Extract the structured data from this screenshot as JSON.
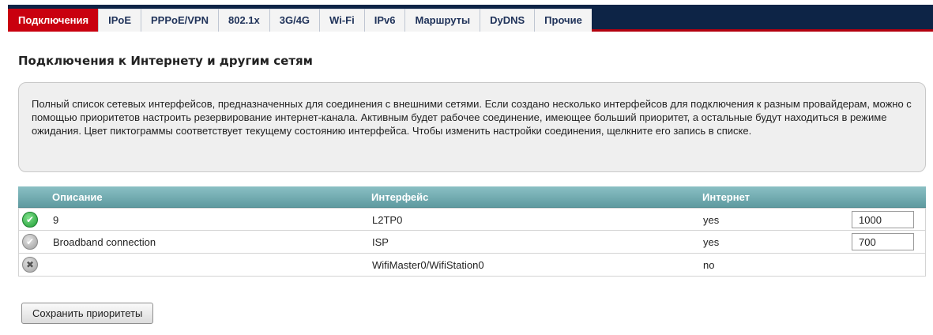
{
  "tabs": [
    {
      "label": "Подключения",
      "active": true
    },
    {
      "label": "IPoE"
    },
    {
      "label": "PPPoE/VPN"
    },
    {
      "label": "802.1x"
    },
    {
      "label": "3G/4G"
    },
    {
      "label": "Wi-Fi"
    },
    {
      "label": "IPv6"
    },
    {
      "label": "Маршруты"
    },
    {
      "label": "DyDNS"
    },
    {
      "label": "Прочие"
    }
  ],
  "page_title": "Подключения к Интернету и другим сетям",
  "info_text": "Полный список сетевых интерфейсов, предназначенных для соединения с внешними сетями. Если создано несколько интерфейсов для подключения к разным провайдерам, можно с помощью приоритетов настроить резервирование интернет-канала. Активным будет рабочее соединение, имеющее больший приоритет, а остальные будут находиться в режиме ожидания. Цвет пиктограммы соответствует текущему состоянию интерфейса. Чтобы изменить настройки соединения, щелкните его запись в списке.",
  "table": {
    "headers": {
      "description": "Описание",
      "interface": "Интерфейс",
      "internet": "Интернет"
    },
    "rows": [
      {
        "status": "connected",
        "status_icon": "check-icon",
        "description": "9",
        "interface": "L2TP0",
        "internet": "yes",
        "priority": "1000"
      },
      {
        "status": "standby",
        "status_icon": "check-icon",
        "description": "Broadband connection",
        "interface": "ISP",
        "internet": "yes",
        "priority": "700"
      },
      {
        "status": "disabled",
        "status_icon": "x-icon",
        "description": "",
        "interface": "WifiMaster0/WifiStation0",
        "internet": "no",
        "priority": ""
      }
    ]
  },
  "save_button": "Сохранить приоритеты",
  "colors": {
    "accent": "#c9000f",
    "tabbar": "#0d2446",
    "table_header": "#6fa9ae"
  }
}
